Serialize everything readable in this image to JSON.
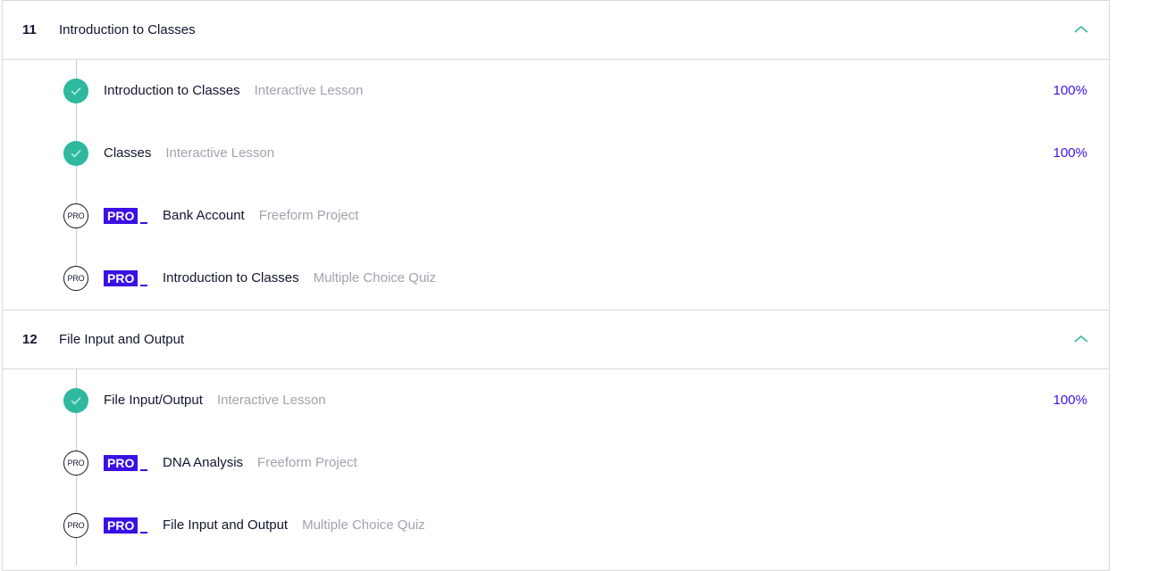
{
  "modules": [
    {
      "number": "11",
      "title": "Introduction to Classes",
      "items": [
        {
          "status": "complete",
          "title": "Introduction to Classes",
          "type": "Interactive Lesson",
          "progress": "100%",
          "pro": false
        },
        {
          "status": "complete",
          "title": "Classes",
          "type": "Interactive Lesson",
          "progress": "100%",
          "pro": false
        },
        {
          "status": "pro",
          "status_label": "PRO",
          "badge": "PRO",
          "title": "Bank Account",
          "type": "Freeform Project",
          "pro": true
        },
        {
          "status": "pro",
          "status_label": "PRO",
          "badge": "PRO",
          "title": "Introduction to Classes",
          "type": "Multiple Choice Quiz",
          "pro": true
        }
      ]
    },
    {
      "number": "12",
      "title": "File Input and Output",
      "items": [
        {
          "status": "complete",
          "title": "File Input/Output",
          "type": "Interactive Lesson",
          "progress": "100%",
          "pro": false
        },
        {
          "status": "pro",
          "status_label": "PRO",
          "badge": "PRO",
          "title": "DNA Analysis",
          "type": "Freeform Project",
          "pro": true
        },
        {
          "status": "pro",
          "status_label": "PRO",
          "badge": "PRO",
          "title": "File Input and Output",
          "type": "Multiple Choice Quiz",
          "pro": true
        }
      ]
    }
  ],
  "colors": {
    "accent": "#3a10e5",
    "complete": "#2eb8a0",
    "chevron": "#2eb8a0",
    "text": "#10162f",
    "muted": "#a0a3ad"
  },
  "icons": {
    "complete": "check-icon",
    "collapse": "chevron-up-icon"
  }
}
